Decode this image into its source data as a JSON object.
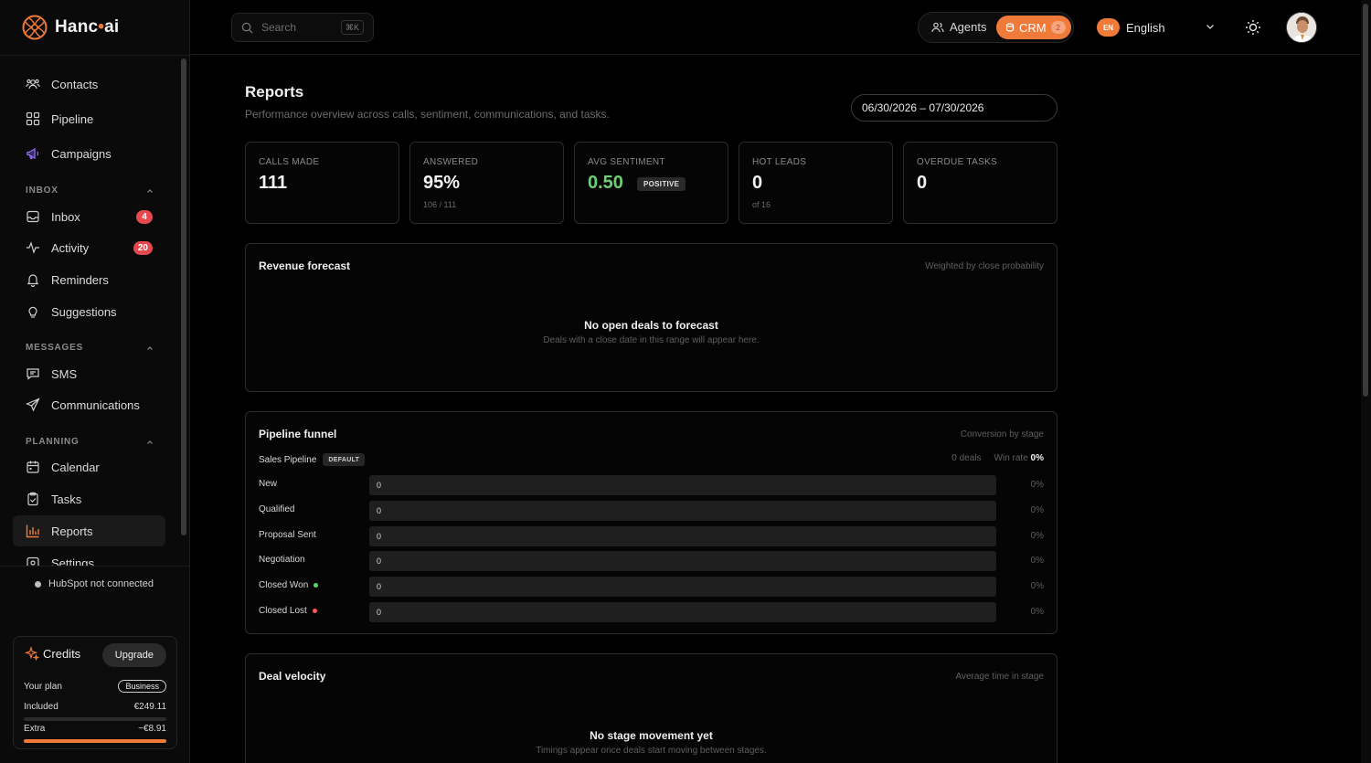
{
  "app": {
    "logo_text_a": "Hanc",
    "logo_text_dot": "•",
    "logo_text_b": "ai"
  },
  "sidebar": {
    "top_items": [
      {
        "label": "Contacts",
        "icon": "contacts-icon"
      },
      {
        "label": "Pipeline",
        "icon": "pipeline-icon"
      },
      {
        "label": "Campaigns",
        "icon": "megaphone-icon"
      }
    ],
    "sections": {
      "inbox": "INBOX",
      "messages": "MESSAGES",
      "planning": "PLANNING"
    },
    "inbox_items": [
      {
        "label": "Inbox",
        "icon": "inbox-icon",
        "badge": "4"
      },
      {
        "label": "Activity",
        "icon": "activity-icon",
        "badge": "20"
      },
      {
        "label": "Reminders",
        "icon": "bell-icon"
      },
      {
        "label": "Suggestions",
        "icon": "lightbulb-icon"
      }
    ],
    "message_items": [
      {
        "label": "SMS",
        "icon": "chat-icon"
      },
      {
        "label": "Communications",
        "icon": "send-icon"
      }
    ],
    "planning_items": [
      {
        "label": "Calendar",
        "icon": "calendar-icon"
      },
      {
        "label": "Tasks",
        "icon": "clipboard-icon"
      },
      {
        "label": "Reports",
        "icon": "bar-chart-icon",
        "active": true
      },
      {
        "label": "Settings",
        "icon": "settings-icon"
      }
    ],
    "hubspot_status": "HubSpot not connected",
    "credits": {
      "title": "Credits",
      "upgrade_label": "Upgrade",
      "plan_label": "Your plan",
      "plan_value": "Business",
      "included_label": "Included",
      "included_value": "€249.11",
      "extra_label": "Extra",
      "extra_value": "−€8.91",
      "extra_fill": 1.0
    }
  },
  "topbar": {
    "search_placeholder": "Search",
    "search_shortcut": "⌘K",
    "agents_label": "Agents",
    "crm_label": "CRM",
    "crm_count": "2",
    "lang_code": "EN",
    "lang_label": "English"
  },
  "page": {
    "title": "Reports",
    "subtitle": "Performance overview across calls, sentiment, communications, and tasks.",
    "date_range": "06/30/2026 – 07/30/2026"
  },
  "kpis": [
    {
      "label": "CALLS MADE",
      "value": "111",
      "sub": ""
    },
    {
      "label": "ANSWERED",
      "value": "95%",
      "sub": "106 / 111"
    },
    {
      "label": "AVG SENTIMENT",
      "value": "0.50",
      "pill": "POSITIVE",
      "sub": ""
    },
    {
      "label": "HOT LEADS",
      "value": "0",
      "sub": "of 16"
    },
    {
      "label": "OVERDUE TASKS",
      "value": "0",
      "sub": ""
    }
  ],
  "revenue": {
    "title": "Revenue forecast",
    "note": "Weighted by close probability",
    "empty_title": "No open deals to forecast",
    "empty_sub": "Deals with a close date in this range will appear here."
  },
  "funnel": {
    "title": "Pipeline funnel",
    "note": "Conversion by stage",
    "pipeline_name": "Sales Pipeline",
    "pipeline_tag": "DEFAULT",
    "deals": "0 deals",
    "win_rate_label": "Win rate",
    "win_rate_value": "0%",
    "stages": [
      {
        "label": "New",
        "count": "0",
        "pct": "0%",
        "dot": ""
      },
      {
        "label": "Qualified",
        "count": "0",
        "pct": "0%",
        "dot": ""
      },
      {
        "label": "Proposal Sent",
        "count": "0",
        "pct": "0%",
        "dot": ""
      },
      {
        "label": "Negotiation",
        "count": "0",
        "pct": "0%",
        "dot": ""
      },
      {
        "label": "Closed Won",
        "count": "0",
        "pct": "0%",
        "dot": "#4cd964"
      },
      {
        "label": "Closed Lost",
        "count": "0",
        "pct": "0%",
        "dot": "#ff5a5f"
      }
    ]
  },
  "velocity": {
    "title": "Deal velocity",
    "note": "Average time in stage",
    "empty_title": "No stage movement yet",
    "empty_sub": "Timings appear once deals start moving between stages."
  },
  "colors": {
    "accent": "#f07a3a",
    "positive": "#6fcf73",
    "badge": "#e5484d"
  }
}
